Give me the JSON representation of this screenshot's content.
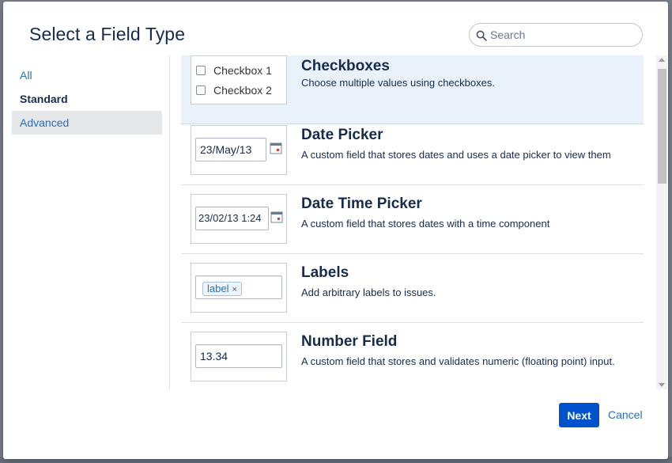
{
  "dialog": {
    "title": "Select a Field Type",
    "search_placeholder": "Search"
  },
  "sidebar": {
    "items": [
      {
        "label": "All"
      },
      {
        "label": "Standard"
      },
      {
        "label": "Advanced",
        "selected": true
      }
    ]
  },
  "fields": [
    {
      "name": "Checkboxes",
      "description": "Choose multiple values using checkboxes.",
      "preview": {
        "options": [
          "Checkbox 1",
          "Checkbox 2"
        ]
      },
      "selected": true
    },
    {
      "name": "Date Picker",
      "description": "A custom field that stores dates and uses a date picker to view them",
      "preview": {
        "value": "23/May/13"
      }
    },
    {
      "name": "Date Time Picker",
      "description": "A custom field that stores dates with a time component",
      "preview": {
        "value": "23/02/13 1:24"
      }
    },
    {
      "name": "Labels",
      "description": "Add arbitrary labels to issues.",
      "preview": {
        "chip": "label",
        "chip_remove": "×"
      }
    },
    {
      "name": "Number Field",
      "description": "A custom field that stores and validates numeric (floating point) input.",
      "preview": {
        "value": "13.34"
      }
    }
  ],
  "footer": {
    "next_label": "Next",
    "cancel_label": "Cancel"
  },
  "colors": {
    "primary": "#0052cc",
    "link": "#2a6ebb",
    "selected_row": "#e9f2fa",
    "selected_sidebar": "#e6e7e9",
    "text": "#172b4d"
  },
  "icons": [
    "search-icon",
    "calendar-icon",
    "close-icon"
  ]
}
